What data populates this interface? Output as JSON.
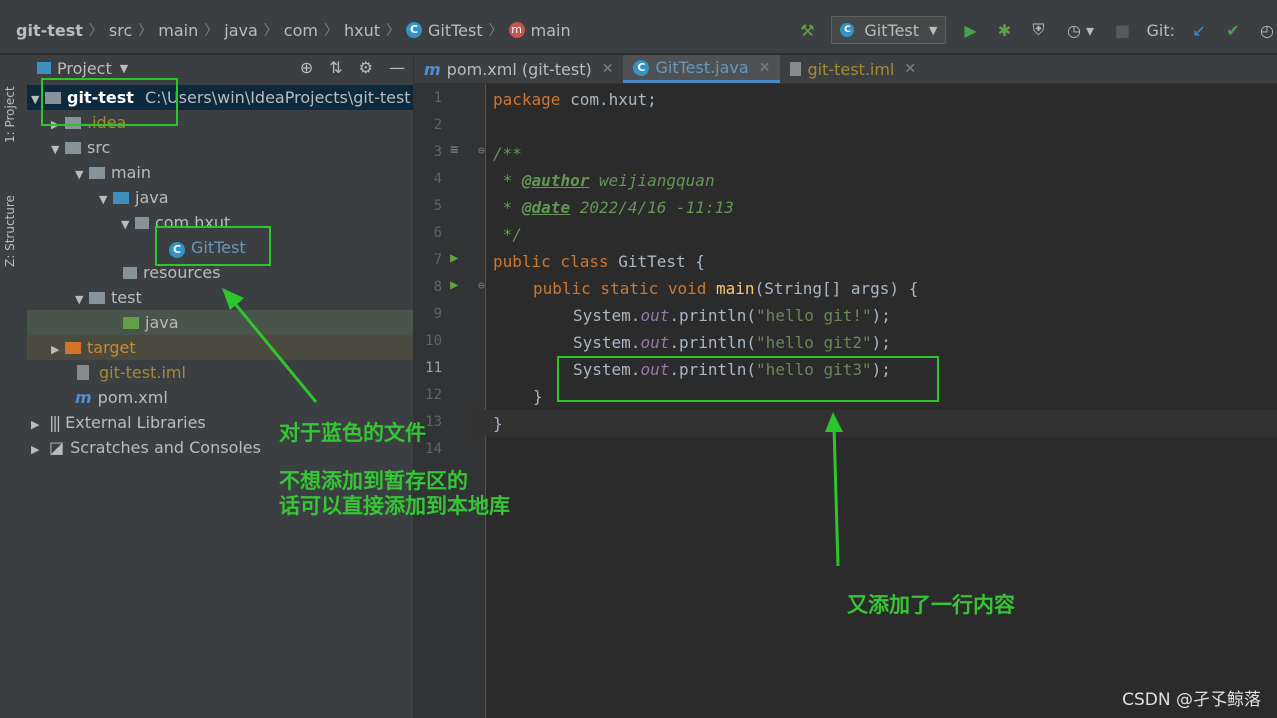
{
  "breadcrumbs": [
    "git-test",
    "src",
    "main",
    "java",
    "com",
    "hxut",
    "GitTest",
    "main"
  ],
  "toolbar": {
    "run_config": "GitTest",
    "git_label": "Git:"
  },
  "side_tabs": {
    "project": "1: Project",
    "structure": "Z: Structure"
  },
  "project_panel": {
    "title": "Project",
    "tree": [
      {
        "label": "git-test",
        "path": "C:\\Users\\win\\IdeaProjects\\git-test"
      },
      {
        "label": ".idea"
      },
      {
        "label": "src"
      },
      {
        "label": "main"
      },
      {
        "label": "java"
      },
      {
        "label": "com.hxut"
      },
      {
        "label": "GitTest"
      },
      {
        "label": "resources"
      },
      {
        "label": "test"
      },
      {
        "label": "java"
      },
      {
        "label": "target"
      },
      {
        "label": "git-test.iml"
      },
      {
        "label": "pom.xml"
      },
      {
        "label": "External Libraries"
      },
      {
        "label": "Scratches and Consoles"
      }
    ]
  },
  "editor_tabs": [
    {
      "label": "pom.xml (git-test)",
      "icon": "m"
    },
    {
      "label": "GitTest.java",
      "icon": "c"
    },
    {
      "label": "git-test.iml",
      "icon": "file"
    }
  ],
  "code": {
    "line_numbers": [
      "1",
      "2",
      "3",
      "4",
      "5",
      "6",
      "7",
      "8",
      "9",
      "10",
      "11",
      "12",
      "13",
      "14"
    ],
    "package_kw": "package",
    "package_name": " com.hxut;",
    "doc_open": "/**",
    "doc_author_prefix": " * ",
    "doc_author_tag": "@author",
    "doc_author_val": " weijiangquan",
    "doc_date_prefix": " * ",
    "doc_date_tag": "@date",
    "doc_date_val": " 2022/4/16 -11:13",
    "doc_close": " */",
    "class_kw": "public class",
    "class_name": " GitTest {",
    "main_kw": "public static void",
    "main_name": "main",
    "main_args": "(String[] args) {",
    "sys1": "System.",
    "out1": "out",
    "print1": ".println(",
    "str1": "\"hello git!\"",
    "end1": ");",
    "sys2": "System.",
    "out2": "out",
    "print2": ".println(",
    "str2": "\"hello git2\"",
    "end2": ");",
    "sys3": "System.",
    "out3": "out",
    "print3": ".println(",
    "str3": "\"hello git3\"",
    "end3": ");",
    "brace_inner": "}",
    "brace_outer": "}"
  },
  "annotations": {
    "blue_file": "对于蓝色的文件",
    "staging_line1": "不想添加到暂存区的",
    "staging_line2": "话可以直接添加到本地库",
    "added_line": "又添加了一行内容"
  },
  "watermark": "CSDN @孑孓鲸落",
  "colors": {
    "annotation_green": "#35c535",
    "selection_blue": "#0d293e",
    "accent": "#4a88c7"
  }
}
